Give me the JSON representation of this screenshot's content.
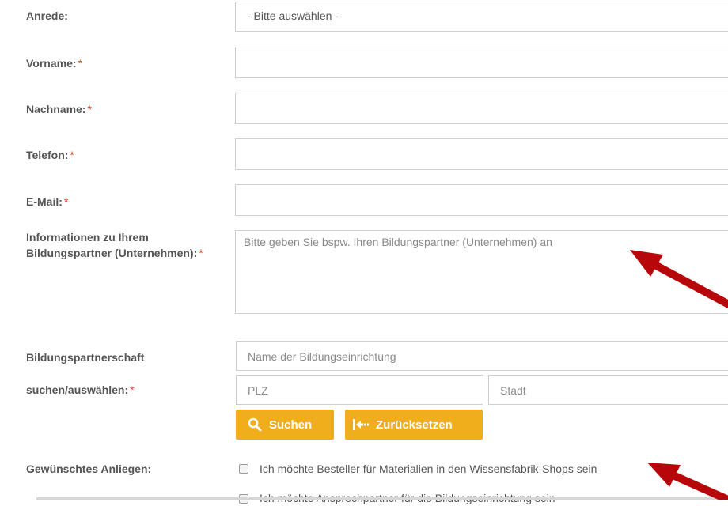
{
  "form": {
    "anrede": {
      "label": "Anrede:",
      "value": "- Bitte auswählen -"
    },
    "vorname": {
      "label": "Vorname:",
      "req": "*"
    },
    "nachname": {
      "label": "Nachname:",
      "req": "*"
    },
    "telefon": {
      "label": "Telefon:",
      "req": "*"
    },
    "email": {
      "label": "E-Mail:",
      "req": "*"
    },
    "info": {
      "label_line1": "Informationen zu Ihrem",
      "label_line2": "Bildungspartner (Unternehmen):",
      "req": "*",
      "placeholder": "Bitte geben Sie bspw. Ihren Bildungspartner (Unternehmen) an"
    },
    "search": {
      "label_line1": "Bildungspartnerschaft",
      "label_line2": "suchen/auswählen:",
      "req": "*",
      "name_placeholder": "Name der Bildungseinrichtung",
      "plz_placeholder": "PLZ",
      "city_placeholder": "Stadt",
      "search_button": "Suchen",
      "reset_button": "Zurücksetzen"
    },
    "anliegen": {
      "label": "Gewünschtes Anliegen:",
      "options": [
        "Ich möchte Besteller für Materialien in den Wissensfabrik-Shops sein",
        "Ich möchte Ansprechpartner für die Bildungseinrichtung sein"
      ]
    }
  },
  "colors": {
    "accent": "#f0ad1c",
    "required": "#e0402a",
    "arrow": "#b8070b"
  },
  "icons": {
    "search": "search-icon",
    "reset": "reset-arrow-icon",
    "caret": "caret-down-icon"
  }
}
